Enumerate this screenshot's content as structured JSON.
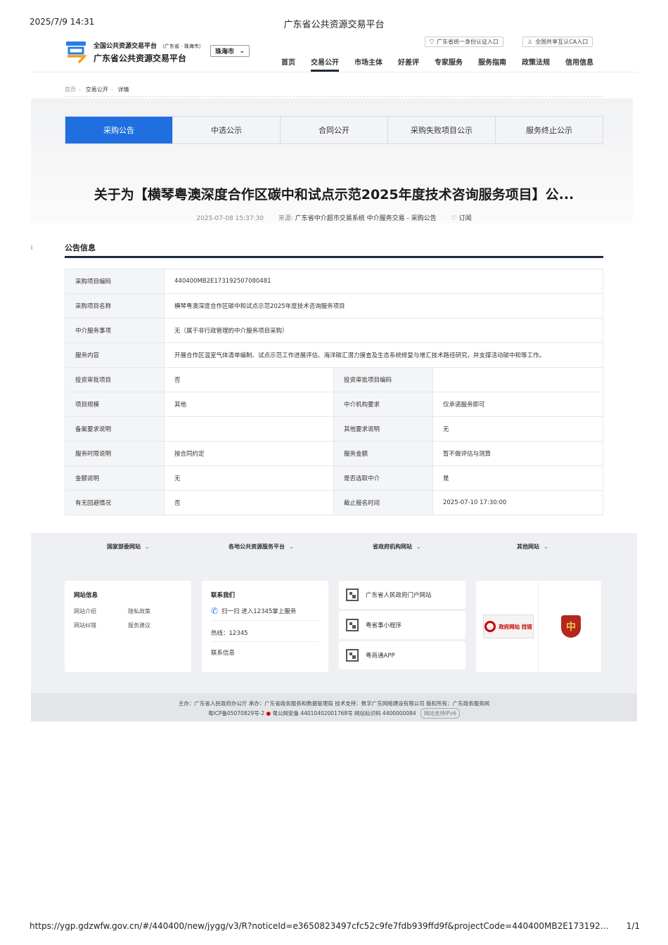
{
  "print": {
    "timestamp": "2025/7/9 14:31",
    "page_title": "广东省公共资源交易平台",
    "url": "https://ygp.gdzwfw.gov.cn/#/440400/new/jygg/v3/R?noticeId=e3650823497cfc52c9fe7fdb939ffd9f&projectCode=440400MB2E173192507080481…",
    "page_num": "1/1"
  },
  "header": {
    "logo_line1": "全国公共资源交易平台",
    "logo_line1_sub": "（广东省 · 珠海市）",
    "logo_line2": "广东省公共资源交易平台",
    "city": "珠海市",
    "auth1": "广东省统一身份认证入口",
    "auth2": "全国共享互认CA入口",
    "nav": [
      "首页",
      "交易公开",
      "市场主体",
      "好差评",
      "专家服务",
      "服务指南",
      "政策法规",
      "信用信息"
    ]
  },
  "breadcrumb": {
    "home": "首页",
    "section": "交易公开",
    "current": "详情"
  },
  "tabs": [
    "采购公告",
    "中选公示",
    "合同公开",
    "采购失败项目公示",
    "服务终止公示"
  ],
  "notice": {
    "title": "关于为【横琴粤澳深度合作区碳中和试点示范2025年度技术咨询服务项目】公...",
    "datetime": "2025-07-08 15:37:30",
    "source_label": "来源:",
    "source": "广东省中介超市交易系统 中介服务交易 - 采购公告",
    "subscribe": "订阅"
  },
  "section_title": "公告信息",
  "side_mark": "l",
  "info": {
    "code_label": "采购项目编码",
    "code": "440400MB2E173192507080481",
    "name_label": "采购项目名称",
    "name": "横琴粤澳深度合作区碳中和试点示范2025年度技术咨询服务项目",
    "agency_label": "中介服务事项",
    "agency": "无（属于非行政管理的中介服务项目采购）",
    "content_label": "服务内容",
    "content": "开展合作区温室气体清单编制、试点示范工作进展评估、海洋碳汇潜力摸查及生态系统修复与增汇技术路径研究，并支撑活动碳中和等工作。",
    "rows": [
      {
        "l1": "投资审批项目",
        "v1": "否",
        "l2": "投资审批项目编码",
        "v2": ""
      },
      {
        "l1": "项目规模",
        "v1": "其他",
        "l2": "中介机构要求",
        "v2": "仅承诺服务即可"
      },
      {
        "l1": "备案要求说明",
        "v1": "",
        "l2": "其他要求说明",
        "v2": "无"
      },
      {
        "l1": "服务时限说明",
        "v1": "按合同约定",
        "l2": "服务金额",
        "v2": "暂不做评估与测算"
      },
      {
        "l1": "金额说明",
        "v1": "无",
        "l2": "是否选取中介",
        "v2": "是"
      },
      {
        "l1": "有无回避情况",
        "v1": "否",
        "l2": "截止报名时间",
        "v2": "2025-07-10 17:30:00"
      }
    ]
  },
  "footer": {
    "links": [
      "国家部委网站",
      "各地公共资源服务平台",
      "省政府机构网站",
      "其他网站"
    ],
    "site_info_title": "网站信息",
    "site_links": [
      "网站介绍",
      "隐私政策",
      "网站纠错",
      "服务建议"
    ],
    "contact_title": "联系我们",
    "scan": "扫一扫 进入12345掌上服务",
    "hotline": "热线：12345",
    "contact_info": "联系信息",
    "qr_items": [
      "广东省人民政府门户网站",
      "粤省事小程序",
      "粤商通APP"
    ],
    "gov_badge": "政府网站 找错",
    "party_badge": "中",
    "bottom_line1": "主办：广东省人民政府办公厅 承办：广东省政务服务和数据管理局 技术支持：数字广东网络建设有限公司 版权所有：广东政务服务网",
    "icp": "粤ICP备05070829号-2",
    "police": "粤公网安备 44010402001768号",
    "site_id": "网站标识码 4400000084",
    "ipv6": "网站支持IPv6"
  }
}
